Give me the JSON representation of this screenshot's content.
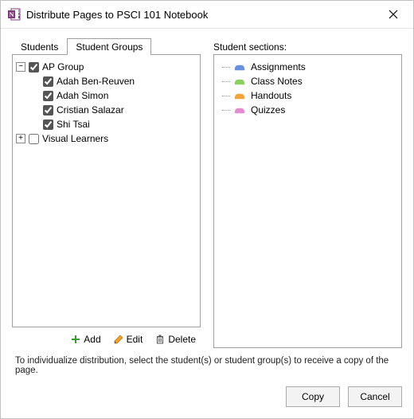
{
  "window": {
    "title": "Distribute Pages to PSCI 101 Notebook",
    "close_label": "Close"
  },
  "tabs": {
    "students": "Students",
    "student_groups": "Student Groups",
    "active": "student_groups"
  },
  "tree": {
    "groups": [
      {
        "name": "AP Group",
        "expanded": true,
        "checked": true,
        "students": [
          {
            "name": "Adah Ben-Reuven",
            "checked": true
          },
          {
            "name": "Adah Simon",
            "checked": true
          },
          {
            "name": "Cristian Salazar",
            "checked": true
          },
          {
            "name": "Shi Tsai",
            "checked": true
          }
        ]
      },
      {
        "name": "Visual Learners",
        "expanded": false,
        "checked": false,
        "students": []
      }
    ]
  },
  "toolbar": {
    "add": "Add",
    "edit": "Edit",
    "delete": "Delete"
  },
  "sections": {
    "label": "Student sections:",
    "items": [
      {
        "name": "Assignments",
        "color": "#6b8fe0"
      },
      {
        "name": "Class Notes",
        "color": "#8ecf63"
      },
      {
        "name": "Handouts",
        "color": "#f1a33e"
      },
      {
        "name": "Quizzes",
        "color": "#e58ecf"
      }
    ]
  },
  "hint": "To individualize distribution, select the student(s) or student group(s) to receive a copy of the page.",
  "buttons": {
    "copy": "Copy",
    "cancel": "Cancel"
  },
  "icons": {
    "app": "onenote-icon",
    "plus": "plus-icon",
    "pencil": "pencil-icon",
    "trash": "trash-icon",
    "close": "close-icon"
  }
}
